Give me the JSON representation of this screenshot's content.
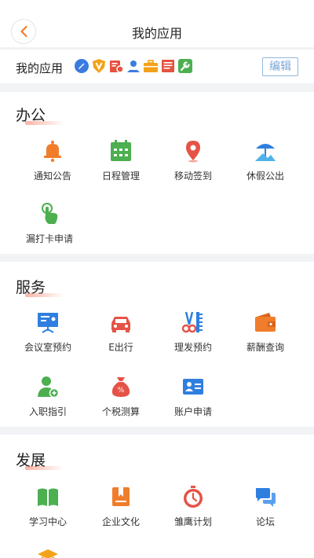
{
  "header": {
    "title": "我的应用"
  },
  "myapps": {
    "label": "我的应用",
    "edit_label": "编辑",
    "icons": [
      "edit-pen-icon",
      "v-shield-icon",
      "cert-icon",
      "user-badge-icon",
      "briefcase-icon",
      "news-icon",
      "wrench-icon"
    ]
  },
  "sections": [
    {
      "title": "办公",
      "items": [
        {
          "label": "通知公告",
          "icon": "bell-icon"
        },
        {
          "label": "日程管理",
          "icon": "calendar-icon"
        },
        {
          "label": "移动签到",
          "icon": "location-pin-icon"
        },
        {
          "label": "休假公出",
          "icon": "beach-umbrella-icon"
        },
        {
          "label": "漏打卡申请",
          "icon": "tap-hand-icon"
        }
      ]
    },
    {
      "title": "服务",
      "items": [
        {
          "label": "会议室预约",
          "icon": "presentation-board-icon"
        },
        {
          "label": "E出行",
          "icon": "car-icon"
        },
        {
          "label": "理发预约",
          "icon": "scissors-comb-icon"
        },
        {
          "label": "薪酬查询",
          "icon": "wallet-icon"
        },
        {
          "label": "入职指引",
          "icon": "person-add-icon"
        },
        {
          "label": "个税测算",
          "icon": "money-bag-icon"
        },
        {
          "label": "账户申请",
          "icon": "id-card-icon"
        }
      ]
    },
    {
      "title": "发展",
      "items": [
        {
          "label": "学习中心",
          "icon": "open-book-icon"
        },
        {
          "label": "企业文化",
          "icon": "bookmark-book-icon"
        },
        {
          "label": "雏鹰计划",
          "icon": "stopwatch-icon"
        },
        {
          "label": "论坛",
          "icon": "chat-bubbles-icon"
        },
        {
          "label": "",
          "icon": "graduation-cap-icon"
        }
      ]
    }
  ],
  "colors": {
    "accent_orange": "#f07d2c",
    "edit_blue": "#7aa7d6",
    "green": "#4caf50",
    "red": "#e55347",
    "blue": "#2f7fe0"
  }
}
